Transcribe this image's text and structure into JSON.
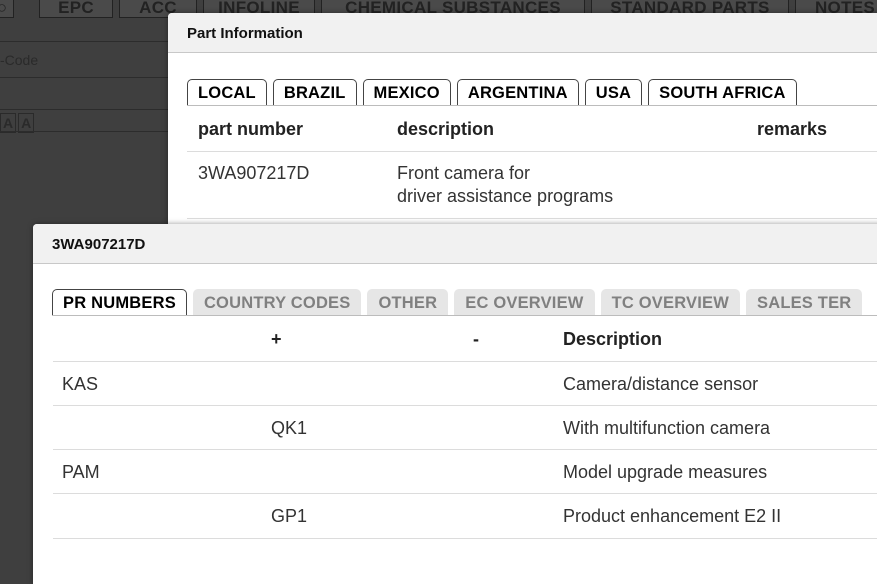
{
  "background": {
    "tabs": [
      "EPC",
      "ACC",
      "INFOLINE",
      "CHEMICAL SUBSTANCES",
      "STANDARD PARTS",
      "NOTES"
    ],
    "code_placeholder": "-Code",
    "font_icons": [
      "A",
      "A"
    ]
  },
  "part_dialog": {
    "title": "Part Information",
    "tabs": [
      "LOCAL",
      "BRAZIL",
      "MEXICO",
      "ARGENTINA",
      "USA",
      "SOUTH AFRICA"
    ],
    "columns": {
      "part_number": "part number",
      "description": "description",
      "remarks": "remarks"
    },
    "rows": [
      {
        "part_number": "3WA907217D",
        "description_line1": "Front camera for",
        "description_line2": "driver assistance programs",
        "remarks": ""
      }
    ]
  },
  "pr_dialog": {
    "title": "3WA907217D",
    "tabs": [
      "PR NUMBERS",
      "COUNTRY CODES",
      "OTHER",
      "EC OVERVIEW",
      "TC OVERVIEW",
      "SALES TER"
    ],
    "columns": {
      "code": "",
      "plus": "+",
      "minus": "-",
      "description": "Description"
    },
    "rows": [
      {
        "code": "KAS",
        "plus": "",
        "minus": "",
        "description": "Camera/distance sensor"
      },
      {
        "code": "",
        "plus": "QK1",
        "minus": "",
        "description": "With multifunction camera"
      },
      {
        "code": "PAM",
        "plus": "",
        "minus": "",
        "description": "Model upgrade measures"
      },
      {
        "code": "",
        "plus": "GP1",
        "minus": "",
        "description": "Product enhancement E2 II"
      }
    ]
  }
}
